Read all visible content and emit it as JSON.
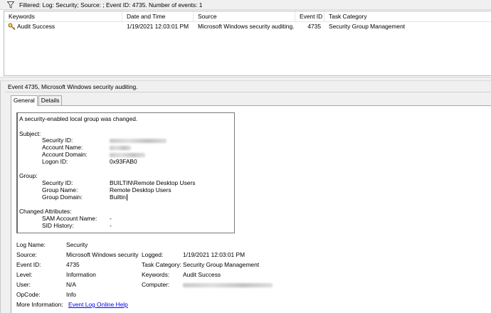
{
  "filter": {
    "text": "Filtered: Log: Security; Source: ; Event ID: 4735. Number of events: 1",
    "icon": "funnel-icon"
  },
  "event_list": {
    "columns": [
      "Keywords",
      "Date and Time",
      "Source",
      "Event ID",
      "Task Category"
    ],
    "rows": [
      {
        "keywords": "Audit Success",
        "date_time": "1/19/2021 12:03:01 PM",
        "source": "Microsoft Windows security auditing.",
        "event_id": "4735",
        "task_category": "Security Group Management",
        "icon": "key-icon"
      }
    ]
  },
  "detail": {
    "title": "Event 4735, Microsoft Windows security auditing.",
    "tabs": [
      "General",
      "Details"
    ],
    "active_tab": "General",
    "message": {
      "summary": "A security-enabled local group was changed.",
      "subject_header": "Subject:",
      "subject": [
        {
          "label": "Security ID:",
          "value": ""
        },
        {
          "label": "Account Name:",
          "value": ""
        },
        {
          "label": "Account Domain:",
          "value": ""
        },
        {
          "label": "Logon ID:",
          "value": "0x93FAB0"
        }
      ],
      "group_header": "Group:",
      "group": [
        {
          "label": "Security ID:",
          "value": "BUILTIN\\Remote Desktop Users"
        },
        {
          "label": "Group Name:",
          "value": "Remote Desktop Users"
        },
        {
          "label": "Group Domain:",
          "value": "Builtin"
        }
      ],
      "changed_header": "Changed Attributes:",
      "changed": [
        {
          "label": "SAM Account Name:",
          "value": "-"
        },
        {
          "label": "SID History:",
          "value": "-"
        }
      ]
    },
    "properties": {
      "log_name_label": "Log Name:",
      "log_name": "Security",
      "source_label": "Source:",
      "source": "Microsoft Windows security",
      "logged_label": "Logged:",
      "logged": "1/19/2021 12:03:01 PM",
      "event_id_label": "Event ID:",
      "event_id": "4735",
      "task_category_label": "Task Category:",
      "task_category": "Security Group Management",
      "level_label": "Level:",
      "level": "Information",
      "keywords_label": "Keywords:",
      "keywords": "Audit Success",
      "user_label": "User:",
      "user": "N/A",
      "computer_label": "Computer:",
      "computer": "",
      "opcode_label": "OpCode:",
      "opcode": "Info",
      "more_info_label": "More Information:",
      "more_info_link": "Event Log Online Help"
    }
  }
}
